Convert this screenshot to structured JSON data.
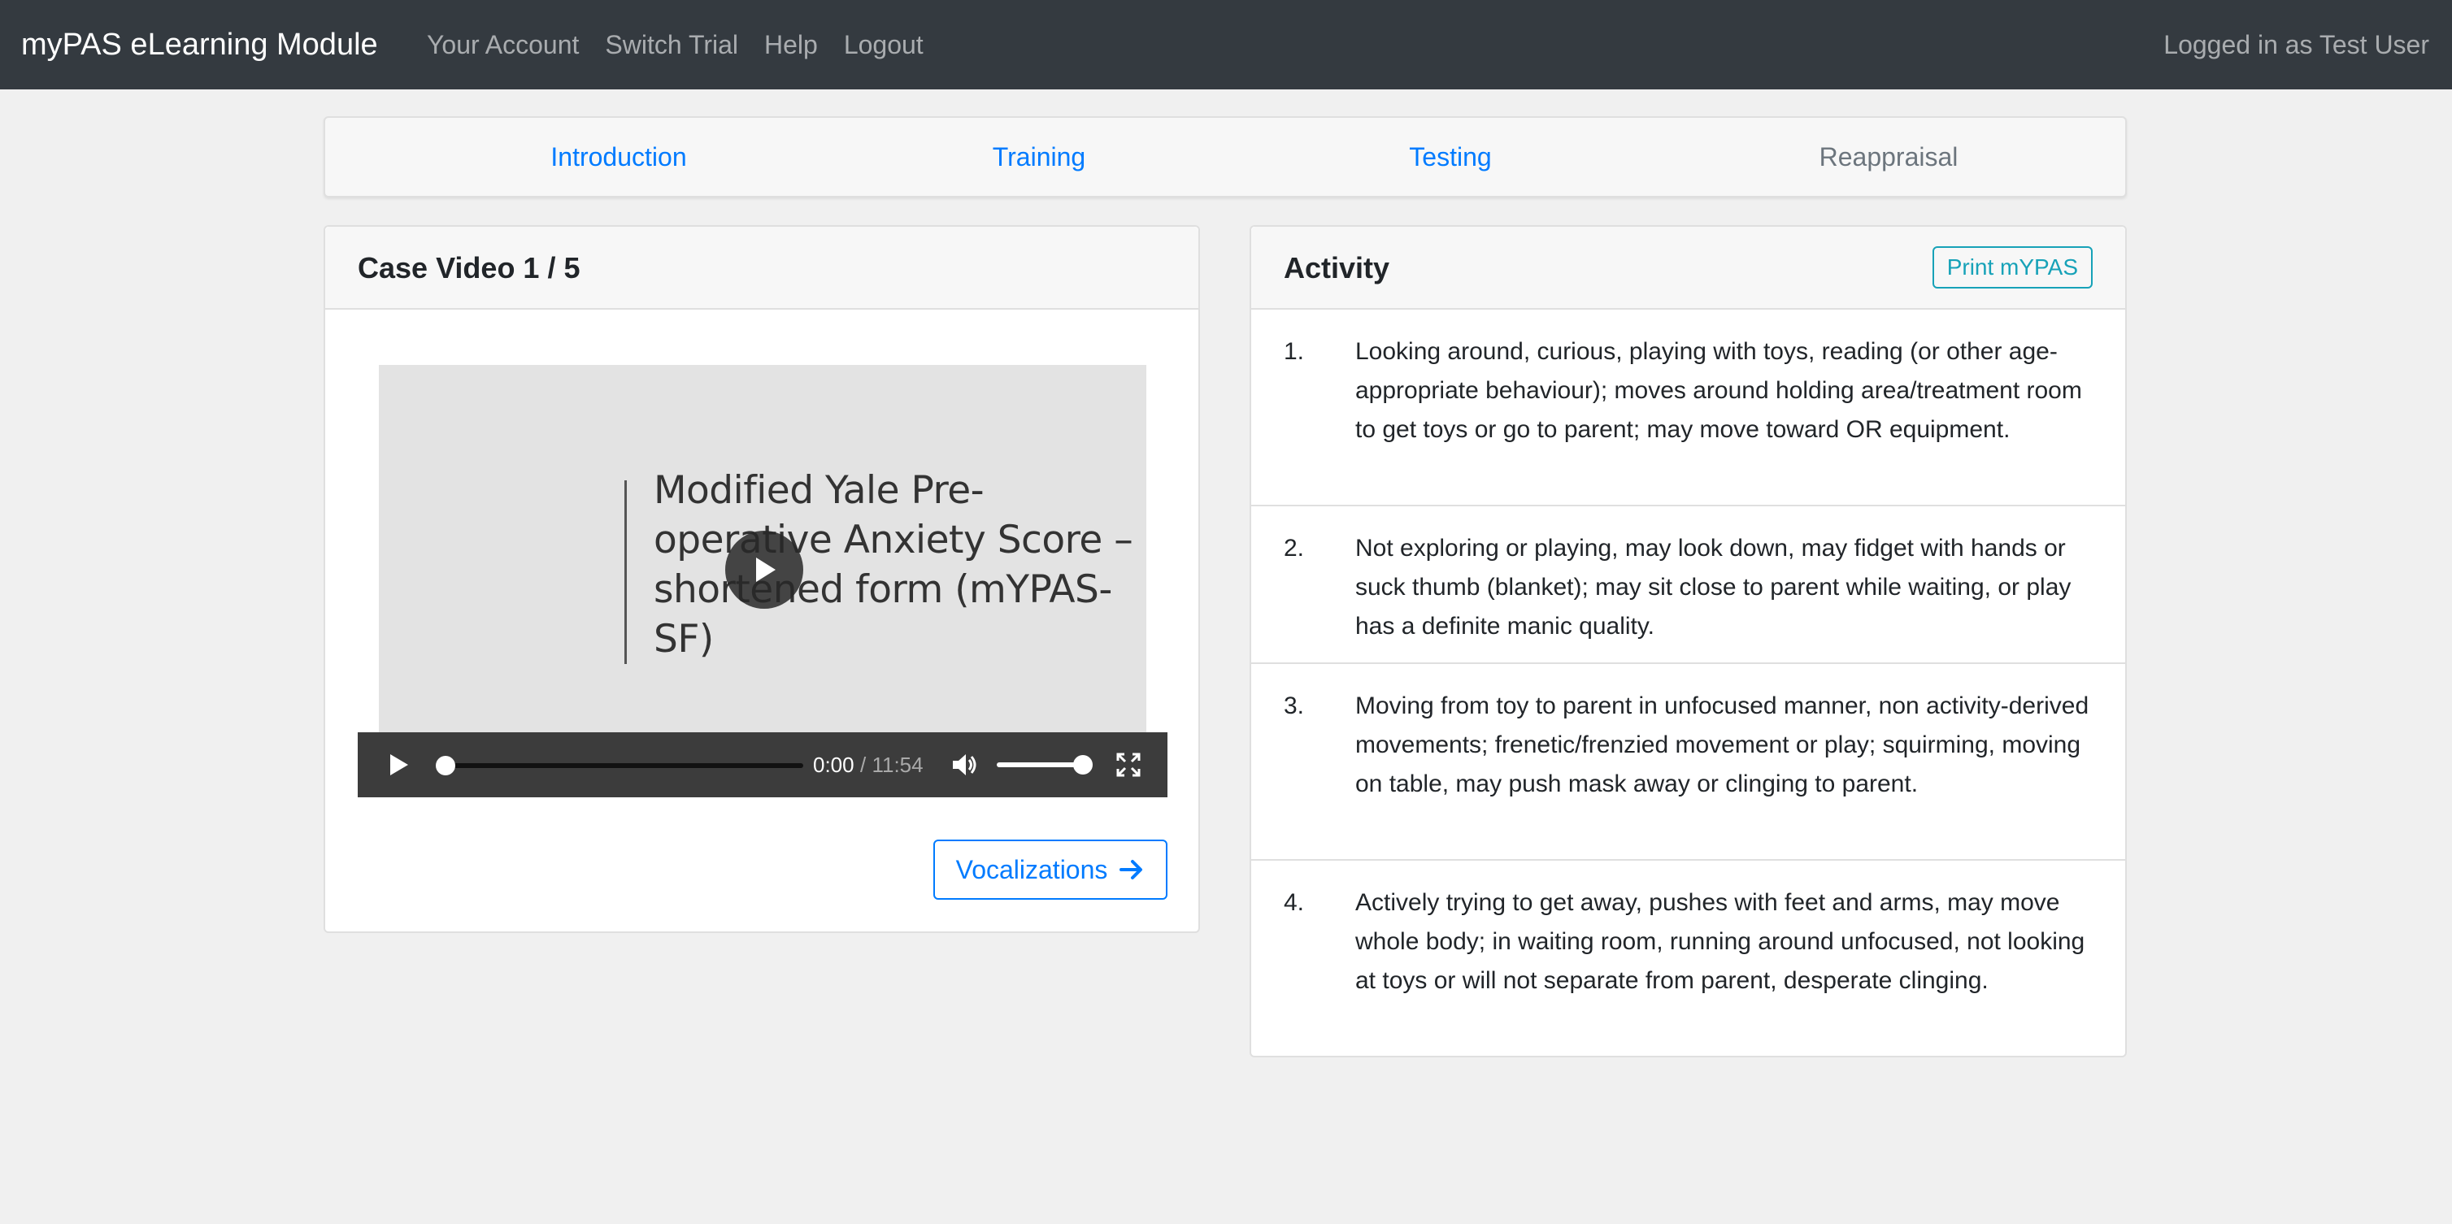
{
  "navbar": {
    "brand": "myPAS eLearning Module",
    "links": [
      "Your Account",
      "Switch Trial",
      "Help",
      "Logout"
    ],
    "logged_in": "Logged in as Test User"
  },
  "tabs": [
    {
      "label": "Introduction",
      "active": true
    },
    {
      "label": "Training",
      "active": true
    },
    {
      "label": "Testing",
      "active": true
    },
    {
      "label": "Reappraisal",
      "active": false
    }
  ],
  "video_card": {
    "title": "Case Video 1 / 5",
    "slide_text": "Modified Yale Pre-operative Anxiety Score – shortened form (mYPAS-SF)",
    "time_current": "0:00",
    "time_total": "/ 11:54",
    "progress": 0,
    "volume": 1.0,
    "next_button": "Vocalizations"
  },
  "activity_card": {
    "title": "Activity",
    "print_button": "Print mYPAS",
    "items": [
      {
        "num": "1.",
        "text": "Looking around, curious, playing with toys, reading (or other age-appropriate behaviour); moves around holding area/treatment room to get toys or go to parent; may move toward OR equipment."
      },
      {
        "num": "2.",
        "text": "Not exploring or playing, may look down, may fidget with hands or suck thumb (blanket); may sit close to parent while waiting, or play has a definite manic quality."
      },
      {
        "num": "3.",
        "text": "Moving from toy to parent in unfocused manner, non activity-derived movements; frenetic/frenzied movement or play; squirming, moving on table, may push mask away or clinging to parent."
      },
      {
        "num": "4.",
        "text": "Actively trying to get away, pushes with feet and arms, may move whole body; in waiting room, running around unfocused, not looking at toys or will not separate from parent, desperate clinging."
      }
    ]
  },
  "colors": {
    "navbar": "#343a40",
    "link_primary": "#007bff",
    "info": "#17a2b8",
    "background": "#f0f0f0"
  }
}
